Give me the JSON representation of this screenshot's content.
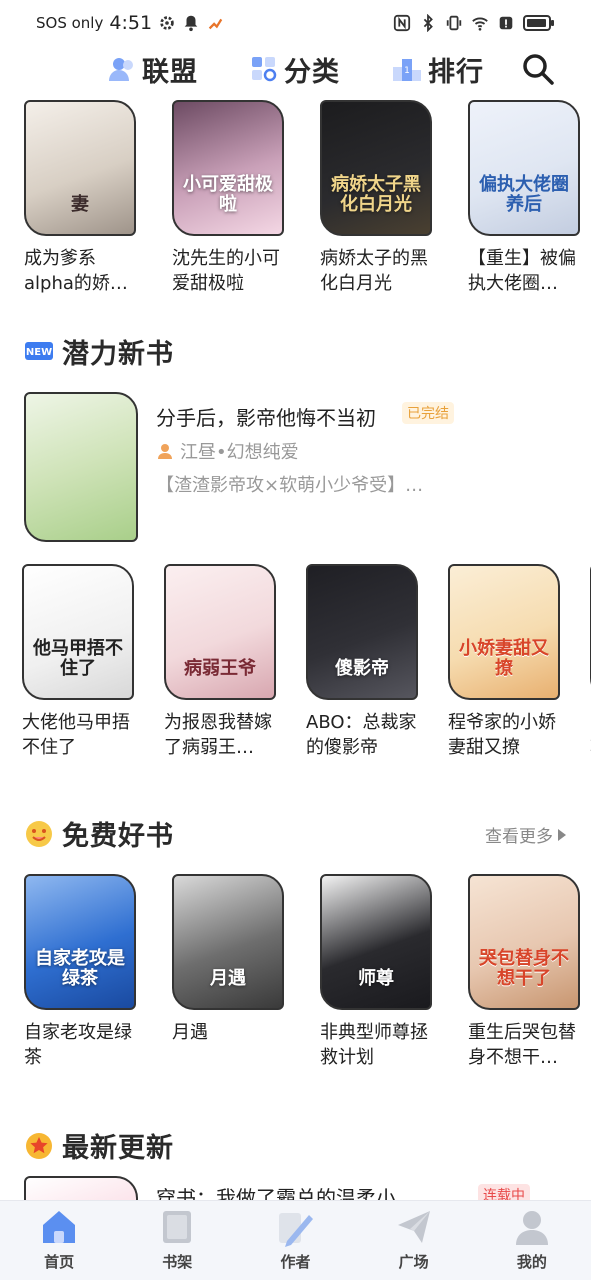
{
  "status_bar": {
    "carrier": "SOS only",
    "time": "4:51"
  },
  "top_nav": {
    "items": [
      {
        "label": "联盟",
        "icon": "user-group-icon"
      },
      {
        "label": "分类",
        "icon": "category-icon"
      },
      {
        "label": "排行",
        "icon": "ranking-icon"
      }
    ],
    "search_icon": "search-icon"
  },
  "row1": {
    "books": [
      {
        "title": "成为爹系alpha的娇…",
        "cover_text": "妻",
        "color": "#e9e3dd"
      },
      {
        "title": "沈先生的小可爱甜极啦",
        "cover_text": "小可爱甜极啦",
        "color": "#c9a0b8"
      },
      {
        "title": "病娇太子的黑化白月光",
        "cover_text": "病娇太子黑化白月光",
        "color": "#2b2b2e"
      },
      {
        "title": "【重生】被偏执大佬圈…",
        "cover_text": "偏执大佬圈养后",
        "color": "#dfe6f2"
      }
    ]
  },
  "potential": {
    "title": "潜力新书",
    "badge_icon": "new-icon",
    "featured": {
      "title": "分手后，影帝他悔不当初",
      "status": "已完结",
      "author": "江昼•幻想纯爱",
      "desc": "【渣渣影帝攻×软萌小少爷受】…"
    },
    "books": [
      {
        "title": "大佬他马甲捂不住了",
        "cover_text": "他马甲捂不住了",
        "color": "#f0f0f0"
      },
      {
        "title": "为报恩我替嫁了病弱王…",
        "cover_text": "病弱王爷",
        "color": "#f2d9dc"
      },
      {
        "title": "ABO：总裁家的傻影帝",
        "cover_text": "傻影帝",
        "color": "#303036"
      },
      {
        "title": "程爷家的小娇妻甜又撩",
        "cover_text": "小娇妻甜又撩",
        "color": "#f6dcb0"
      },
      {
        "title": "欧软",
        "cover_text": "",
        "color": "#e85b4a"
      }
    ]
  },
  "free": {
    "title": "免费好书",
    "see_more": "查看更多",
    "icon": "smile-icon",
    "books": [
      {
        "title": "自家老攻是绿茶",
        "cover_text": "自家老攻是绿茶",
        "color": "#2f6fd1"
      },
      {
        "title": "月遇",
        "cover_text": "月遇",
        "color": "#6e6e6e"
      },
      {
        "title": "非典型师尊拯救计划",
        "cover_text": "师尊",
        "color": "#2a2a2e"
      },
      {
        "title": "重生后哭包替身不想干…",
        "cover_text": "哭包替身不想干了",
        "color": "#e7c7b0"
      }
    ]
  },
  "latest": {
    "title": "最新更新",
    "icon": "star-icon",
    "first_title": "穿书：我做了霸总的温柔小",
    "first_status": "连载中"
  },
  "tab_bar": {
    "tabs": [
      {
        "label": "首页",
        "icon": "home-icon"
      },
      {
        "label": "书架",
        "icon": "bookshelf-icon"
      },
      {
        "label": "作者",
        "icon": "author-pen-icon"
      },
      {
        "label": "广场",
        "icon": "plaza-plane-icon"
      },
      {
        "label": "我的",
        "icon": "profile-icon"
      }
    ]
  }
}
